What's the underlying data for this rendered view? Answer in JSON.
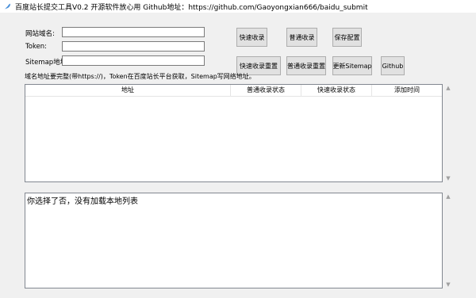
{
  "window": {
    "title": "百度站长提交工具V0.2 开源软件放心用 Github地址：https://github.com/Gaoyongxian666/baidu_submit",
    "icon": "feather-app-icon"
  },
  "form": {
    "domain_label": "网站域名:",
    "domain_value": "",
    "token_label": "Token:",
    "token_value": "",
    "sitemap_label": "Sitemap地址:",
    "sitemap_value": ""
  },
  "buttons": {
    "fast_submit": "快速收录",
    "normal_submit": "普通收录",
    "save_config": "保存配置",
    "fast_reset": "快速收录重置",
    "normal_reset": "普通收录重置",
    "update_sitemap": "更新Sitemap",
    "github": "Github"
  },
  "hint": "域名地址要完整(带https://)，Token在百度站长平台获取，Sitemap写网络地址。",
  "table": {
    "columns": [
      "地址",
      "普通收录状态",
      "快速收录状态",
      "添加时间"
    ],
    "rows": []
  },
  "log": {
    "text": "你选择了否，没有加载本地列表"
  }
}
